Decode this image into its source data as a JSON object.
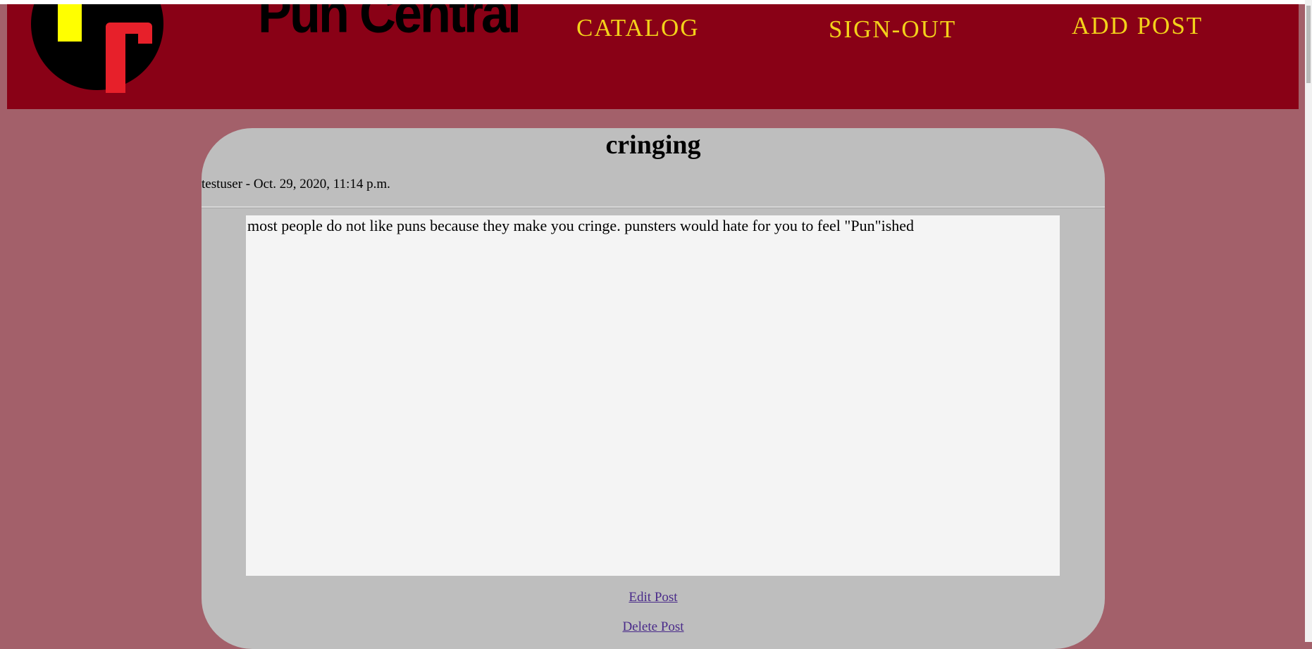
{
  "header": {
    "logo": {
      "icon": "pun-central-logo-icon",
      "letters": "PC",
      "colors": {
        "circle": "#000000",
        "p": "#ffff00",
        "c": "#e7202a"
      }
    },
    "brand": "Pun Central",
    "nav": [
      {
        "label": "CATALOG"
      },
      {
        "label": "SIGN-OUT"
      },
      {
        "label": "ADD POST"
      }
    ]
  },
  "post": {
    "title": "cringing",
    "author": "testuser",
    "separator": " - ",
    "date": "Oct. 29, 2020, 11:14 p.m.",
    "body": "most people do not like puns because they make you cringe. punsters would hate for you to feel \"Pun\"ished",
    "edit_label": "Edit Post",
    "delete_label": "Delete Post"
  },
  "colors": {
    "page_bg": "#a3606a",
    "header_bg": "#890116",
    "nav_text": "#f3d21a",
    "card_bg": "#bebebe",
    "body_bg": "#f4f4f4",
    "link": "#4a2b8a"
  }
}
